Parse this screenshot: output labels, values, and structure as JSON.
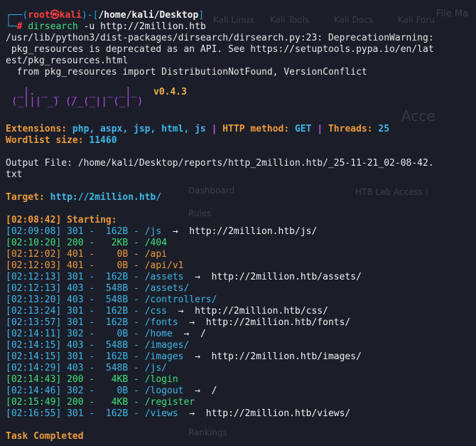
{
  "prompt": {
    "user": "root",
    "skull": "㉿",
    "host": "kali",
    "path": "/home/kali/Desktop",
    "symbol": "#",
    "command_name": "dirsearch",
    "command_args": "-u http://2million.htb"
  },
  "warning_lines": [
    "/usr/lib/python3/dist-packages/dirsearch/dirsearch.py:23: DeprecationWarning:",
    " pkg_resources is deprecated as an API. See https://setuptools.pypa.io/en/lat",
    "est/pkg_resources.html",
    "  from pkg_resources import DistributionNotFound, VersionConflict"
  ],
  "banner": {
    "art_row1": " _|. _ _  _  _  _ _|_",
    "art_row2": "(_||| _) (/_(_|| (_| )",
    "version": "v0.4.3"
  },
  "config": {
    "extensions_label": "Extensions:",
    "extensions": "php, aspx, jsp, html, js",
    "sep": "|",
    "method_label": "HTTP method:",
    "method": "GET",
    "threads_label": "Threads:",
    "threads": "25",
    "wordlist_label": "Wordlist size:",
    "wordlist": "11460"
  },
  "output_file": {
    "line1": "Output File: /home/kali/Desktop/reports/http_2million.htb/_25-11-21_02-08-42.",
    "line2": "txt"
  },
  "target": {
    "label": "Target:",
    "url": "http://2million.htb/"
  },
  "starting": {
    "time": "[02:08:42]",
    "label": "Starting:"
  },
  "results": [
    {
      "time": "[02:09:08]",
      "status": "301",
      "size": "162B",
      "path": "/js",
      "redirect": "http://2million.htb/js/"
    },
    {
      "time": "[02:10:20]",
      "status": "200",
      "size": "2KB",
      "path": "/404",
      "redirect": ""
    },
    {
      "time": "[02:12:02]",
      "status": "401",
      "size": "0B",
      "path": "/api",
      "redirect": ""
    },
    {
      "time": "[02:12:03]",
      "status": "401",
      "size": "0B",
      "path": "/api/v1",
      "redirect": ""
    },
    {
      "time": "[02:12:13]",
      "status": "301",
      "size": "162B",
      "path": "/assets",
      "redirect": "http://2million.htb/assets/"
    },
    {
      "time": "[02:12:13]",
      "status": "403",
      "size": "548B",
      "path": "/assets/",
      "redirect": ""
    },
    {
      "time": "[02:13:20]",
      "status": "403",
      "size": "548B",
      "path": "/controllers/",
      "redirect": ""
    },
    {
      "time": "[02:13:24]",
      "status": "301",
      "size": "162B",
      "path": "/css",
      "redirect": "http://2million.htb/css/"
    },
    {
      "time": "[02:13:57]",
      "status": "301",
      "size": "162B",
      "path": "/fonts",
      "redirect": "http://2million.htb/fonts/"
    },
    {
      "time": "[02:14:11]",
      "status": "302",
      "size": "0B",
      "path": "/home",
      "redirect": "/"
    },
    {
      "time": "[02:14:15]",
      "status": "403",
      "size": "548B",
      "path": "/images/",
      "redirect": ""
    },
    {
      "time": "[02:14:15]",
      "status": "301",
      "size": "162B",
      "path": "/images",
      "redirect": "http://2million.htb/images/"
    },
    {
      "time": "[02:14:29]",
      "status": "403",
      "size": "548B",
      "path": "/js/",
      "redirect": ""
    },
    {
      "time": "[02:14:43]",
      "status": "200",
      "size": "4KB",
      "path": "/login",
      "redirect": ""
    },
    {
      "time": "[02:14:46]",
      "status": "302",
      "size": "0B",
      "path": "/logout",
      "redirect": "/"
    },
    {
      "time": "[02:15:49]",
      "status": "200",
      "size": "4KB",
      "path": "/register",
      "redirect": ""
    },
    {
      "time": "[02:16:55]",
      "status": "301",
      "size": "162B",
      "path": "/views",
      "redirect": "http://2million.htb/views/"
    }
  ],
  "arrow": "→",
  "task_completed": "Task Completed",
  "colors": {
    "background": "#1b1e29",
    "prompt_blue": "#2b9fe6",
    "root_red": "#ff3d3d",
    "orange": "#ef9a3b",
    "cyan": "#3fb7e8",
    "status_200": "#3ee07a",
    "status_301": "#3fb7e8",
    "status_302": "#3fb7e8",
    "status_401": "#ef9a3b",
    "status_403": "#3fb7e8"
  }
}
